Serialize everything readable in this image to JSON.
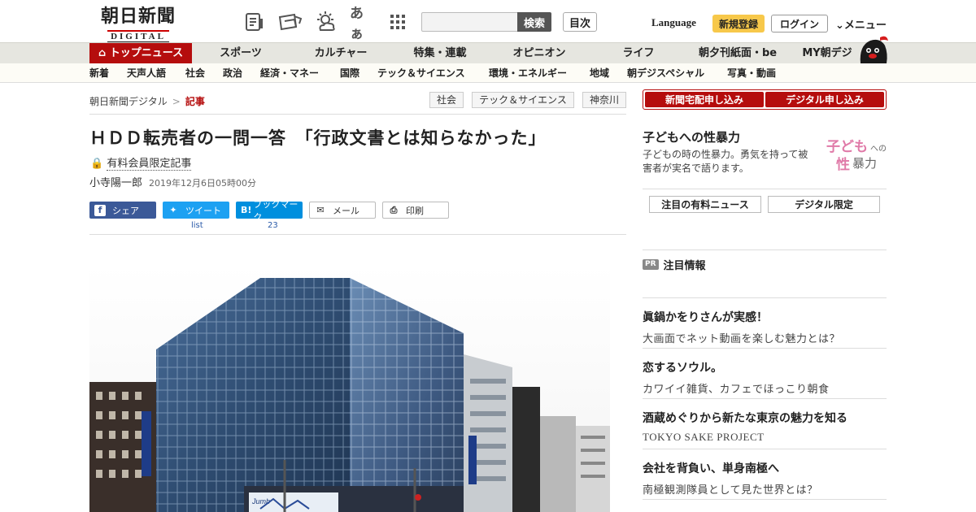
{
  "header": {
    "logo_jp": "朝日新聞",
    "logo_digital": "DIGITAL",
    "font_size_icon_label": "あぁ",
    "search": {
      "placeholder": "",
      "button": "検索"
    },
    "mokuji": "目次",
    "language": "Language",
    "register": "新規登録",
    "login": "ログイン",
    "menu": "メニュー"
  },
  "mainnav": {
    "items": [
      "トップニュース",
      "スポーツ",
      "カルチャー",
      "特集・連載",
      "オピニオン",
      "ライフ",
      "朝夕刊紙面・be",
      "MY朝デジ"
    ]
  },
  "subnav": {
    "items": [
      "新着",
      "天声人語",
      "社会",
      "政治",
      "経済・マネー",
      "国際",
      "テック＆サイエンス",
      "環境・エネルギー",
      "地域",
      "朝デジスペシャル",
      "写真・動画"
    ]
  },
  "breadcrumb": {
    "home": "朝日新聞デジタル",
    "sep": ">",
    "current": "記事"
  },
  "tags": [
    "社会",
    "テック＆サイエンス",
    "神奈川"
  ],
  "article": {
    "headline": "ＨＤＤ転売者の一問一答　「行政文書とは知らなかった」",
    "paid_label": "有料会員限定記事",
    "author": "小寺陽一郎",
    "date": "2019年12月6日05時00分"
  },
  "share": {
    "facebook": "シェア",
    "twitter": "ツイート",
    "twitter_count": "list",
    "hatena": "ブックマーク",
    "hatena_icon": "B!",
    "hatena_count": "23",
    "mail": "メール",
    "print": "印刷"
  },
  "photo": {
    "sign_text": "Jumb"
  },
  "sidebar": {
    "subscribe_paper": "新聞宅配申し込み",
    "subscribe_digital": "デジタル申し込み",
    "feature": {
      "title": "子どもへの性暴力",
      "desc": "子どもの時の性暴力。勇気を持って被害者が実名で語ります。",
      "logo_line1": "子ども",
      "logo_small1": "への",
      "logo_line2": "性",
      "logo_line2b": "暴力"
    },
    "tabs": [
      "注目の有料ニュース",
      "デジタル限定"
    ],
    "pr_badge": "PR",
    "pr_heading": "注目情報",
    "pr_items": [
      {
        "title": "眞鍋かをりさんが実感！",
        "sub": "大画面でネット動画を楽しむ魅力とは？"
      },
      {
        "title": "恋するソウル。",
        "sub": "カワイイ雑貨、カフェでほっこり朝食"
      },
      {
        "title": "酒蔵めぐりから新たな東京の魅力を知る",
        "sub": "TOKYO SAKE PROJECT"
      },
      {
        "title": "会社を背負い、単身南極へ",
        "sub": "南極観測隊員として見た世界とは？"
      }
    ]
  },
  "colors": {
    "brand_red": "#b50d0d",
    "register_yellow": "#f7c84a",
    "facebook": "#3b5998",
    "twitter": "#1da1f2",
    "hatena": "#008fde"
  }
}
